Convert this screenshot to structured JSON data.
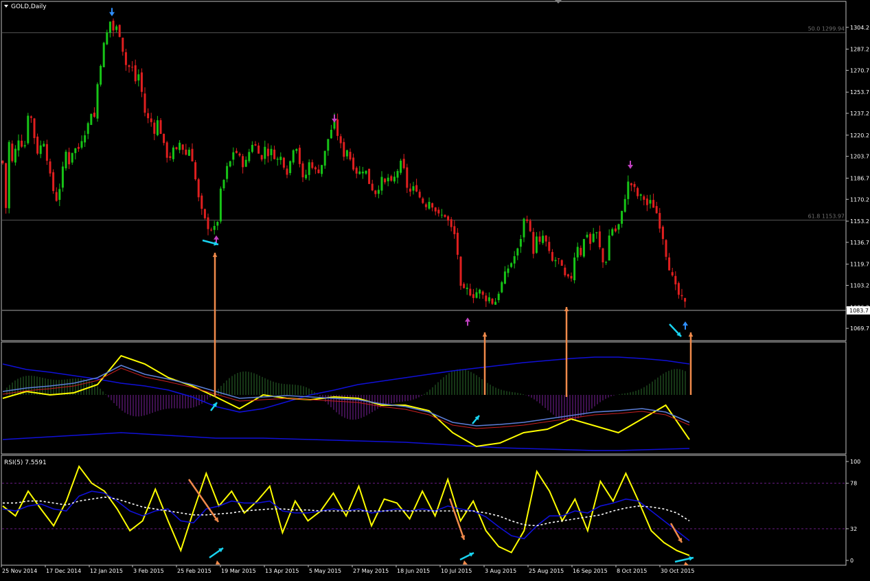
{
  "window": {
    "symbol_label": "GOLD,Daily",
    "rsi_label": "RSI(5) 7.5591"
  },
  "colors": {
    "bg": "#000000",
    "grid": "#2f3b2f",
    "axis": "#c0c0c0",
    "bull": "#17c417",
    "bear": "#e01f1f",
    "yellow": "#ffff00",
    "blue": "#1010d8",
    "lightblue": "#5c7fd8",
    "orange": "#f08a4b",
    "cyan": "#19d3f0",
    "purple": "#a020a0",
    "fib": "#707070",
    "price_line": "#c0c0c0"
  },
  "icons": {
    "dropdown": "triangle-down-icon",
    "buy": "arrow-up-icon",
    "sell": "arrow-down-icon"
  },
  "chart_data": [
    {
      "type": "candlestick",
      "title": "GOLD,Daily",
      "ylim": [
        1061.2,
        1321.2
      ],
      "y_ticks": [
        "1304.2",
        "1287.2",
        "1270.7",
        "1253.7",
        "1237.2",
        "1220.2",
        "1203.7",
        "1186.7",
        "1170.2",
        "1153.2",
        "1136.7",
        "1119.7",
        "1103.2",
        "1086.2",
        "1069.7"
      ],
      "x_ticks": [
        "25 Nov 2014",
        "17 Dec 2014",
        "12 Jan 2015",
        "3 Feb 2015",
        "25 Feb 2015",
        "19 Mar 2015",
        "13 Apr 2015",
        "5 May 2015",
        "27 May 2015",
        "18 Jun 2015",
        "10 Jul 2015",
        "3 Aug 2015",
        "25 Aug 2015",
        "16 Sep 2015",
        "8 Oct 2015",
        "30 Oct 2015"
      ],
      "current_price": "1083.7",
      "fib_levels": [
        {
          "label": "50.0 1299.94",
          "value": 1299.94
        },
        {
          "label": "61.8 1153.97",
          "value": 1153.97
        }
      ],
      "close_path": [
        [
          0,
          1200
        ],
        [
          5,
          1198
        ],
        [
          9,
          1160
        ],
        [
          13,
          1215
        ],
        [
          19,
          1195
        ],
        [
          24,
          1215
        ],
        [
          29,
          1220
        ],
        [
          35,
          1205
        ],
        [
          40,
          1238
        ],
        [
          47,
          1232
        ],
        [
          52,
          1210
        ],
        [
          57,
          1205
        ],
        [
          62,
          1220
        ],
        [
          67,
          1208
        ],
        [
          72,
          1190
        ],
        [
          77,
          1178
        ],
        [
          82,
          1170
        ],
        [
          87,
          1180
        ],
        [
          92,
          1195
        ],
        [
          97,
          1210
        ],
        [
          102,
          1195
        ],
        [
          107,
          1215
        ],
        [
          112,
          1205
        ],
        [
          117,
          1215
        ],
        [
          122,
          1222
        ],
        [
          127,
          1225
        ],
        [
          132,
          1240
        ],
        [
          137,
          1232
        ],
        [
          142,
          1260
        ],
        [
          146,
          1275
        ],
        [
          151,
          1290
        ],
        [
          156,
          1300
        ],
        [
          161,
          1310
        ],
        [
          166,
          1300
        ],
        [
          171,
          1305
        ],
        [
          176,
          1296
        ],
        [
          181,
          1280
        ],
        [
          186,
          1270
        ],
        [
          191,
          1278
        ],
        [
          196,
          1260
        ],
        [
          201,
          1270
        ],
        [
          206,
          1255
        ],
        [
          211,
          1238
        ],
        [
          216,
          1232
        ],
        [
          221,
          1230
        ],
        [
          226,
          1222
        ],
        [
          231,
          1235
        ],
        [
          236,
          1215
        ],
        [
          241,
          1208
        ],
        [
          246,
          1200
        ],
        [
          251,
          1210
        ],
        [
          256,
          1205
        ],
        [
          261,
          1215
        ],
        [
          266,
          1210
        ],
        [
          271,
          1205
        ],
        [
          276,
          1210
        ],
        [
          281,
          1200
        ],
        [
          286,
          1180
        ],
        [
          291,
          1165
        ],
        [
          296,
          1157
        ],
        [
          301,
          1150
        ],
        [
          306,
          1148
        ],
        [
          311,
          1146
        ],
        [
          316,
          1150
        ],
        [
          321,
          1175
        ],
        [
          326,
          1185
        ],
        [
          331,
          1195
        ],
        [
          336,
          1200
        ],
        [
          341,
          1210
        ],
        [
          346,
          1205
        ],
        [
          351,
          1200
        ],
        [
          356,
          1196
        ],
        [
          361,
          1203
        ],
        [
          366,
          1215
        ],
        [
          371,
          1212
        ],
        [
          376,
          1210
        ],
        [
          381,
          1200
        ],
        [
          386,
          1212
        ],
        [
          391,
          1205
        ],
        [
          396,
          1208
        ],
        [
          401,
          1203
        ],
        [
          406,
          1200
        ],
        [
          411,
          1205
        ],
        [
          416,
          1190
        ],
        [
          421,
          1195
        ],
        [
          426,
          1210
        ],
        [
          431,
          1214
        ],
        [
          436,
          1200
        ],
        [
          441,
          1185
        ],
        [
          446,
          1190
        ],
        [
          451,
          1200
        ],
        [
          456,
          1196
        ],
        [
          461,
          1190
        ],
        [
          466,
          1195
        ],
        [
          471,
          1200
        ],
        [
          476,
          1215
        ],
        [
          481,
          1222
        ],
        [
          486,
          1232
        ],
        [
          491,
          1222
        ],
        [
          496,
          1212
        ],
        [
          501,
          1205
        ],
        [
          506,
          1210
        ],
        [
          511,
          1200
        ],
        [
          516,
          1195
        ],
        [
          521,
          1190
        ],
        [
          526,
          1192
        ],
        [
          531,
          1196
        ],
        [
          536,
          1185
        ],
        [
          541,
          1180
        ],
        [
          546,
          1175
        ],
        [
          551,
          1180
        ],
        [
          556,
          1185
        ],
        [
          561,
          1182
        ],
        [
          566,
          1188
        ],
        [
          571,
          1180
        ],
        [
          576,
          1190
        ],
        [
          581,
          1195
        ],
        [
          586,
          1200
        ],
        [
          591,
          1183
        ],
        [
          596,
          1175
        ],
        [
          601,
          1178
        ],
        [
          606,
          1180
        ],
        [
          611,
          1172
        ],
        [
          616,
          1168
        ],
        [
          621,
          1166
        ],
        [
          626,
          1170
        ],
        [
          631,
          1165
        ],
        [
          636,
          1160
        ],
        [
          641,
          1155
        ],
        [
          646,
          1160
        ],
        [
          651,
          1155
        ],
        [
          656,
          1148
        ],
        [
          661,
          1145
        ],
        [
          666,
          1130
        ],
        [
          671,
          1100
        ],
        [
          676,
          1098
        ],
        [
          681,
          1100
        ],
        [
          686,
          1097
        ],
        [
          691,
          1095
        ],
        [
          696,
          1100
        ],
        [
          701,
          1097
        ],
        [
          706,
          1092
        ],
        [
          711,
          1095
        ],
        [
          716,
          1090
        ],
        [
          721,
          1090
        ],
        [
          726,
          1098
        ],
        [
          731,
          1105
        ],
        [
          736,
          1112
        ],
        [
          741,
          1118
        ],
        [
          746,
          1122
        ],
        [
          751,
          1128
        ],
        [
          756,
          1132
        ],
        [
          761,
          1150
        ],
        [
          766,
          1160
        ],
        [
          771,
          1148
        ],
        [
          776,
          1128
        ],
        [
          781,
          1140
        ],
        [
          786,
          1135
        ],
        [
          791,
          1142
        ],
        [
          796,
          1135
        ],
        [
          801,
          1125
        ],
        [
          806,
          1120
        ],
        [
          811,
          1125
        ],
        [
          816,
          1120
        ],
        [
          821,
          1110
        ],
        [
          826,
          1108
        ],
        [
          831,
          1106
        ],
        [
          836,
          1125
        ],
        [
          841,
          1135
        ],
        [
          846,
          1128
        ],
        [
          851,
          1140
        ],
        [
          856,
          1145
        ],
        [
          861,
          1132
        ],
        [
          866,
          1150
        ],
        [
          871,
          1138
        ],
        [
          876,
          1125
        ],
        [
          881,
          1115
        ],
        [
          886,
          1140
        ],
        [
          891,
          1148
        ],
        [
          896,
          1145
        ],
        [
          901,
          1150
        ],
        [
          906,
          1160
        ],
        [
          911,
          1175
        ],
        [
          916,
          1185
        ],
        [
          921,
          1180
        ],
        [
          926,
          1176
        ],
        [
          931,
          1170
        ],
        [
          936,
          1174
        ],
        [
          941,
          1165
        ],
        [
          946,
          1168
        ],
        [
          951,
          1166
        ],
        [
          956,
          1160
        ],
        [
          961,
          1150
        ],
        [
          966,
          1140
        ],
        [
          971,
          1125
        ],
        [
          976,
          1115
        ],
        [
          981,
          1105
        ],
        [
          986,
          1098
        ],
        [
          991,
          1093
        ],
        [
          996,
          1090
        ],
        [
          1001,
          1085
        ]
      ],
      "signals": [
        {
          "kind": "sell",
          "x": 163,
          "price": 1315,
          "color": "blue"
        },
        {
          "kind": "sell",
          "x": 487,
          "price": 1232,
          "color": "purple"
        },
        {
          "kind": "sell",
          "x": 918,
          "price": 1196,
          "color": "purple"
        },
        {
          "kind": "buy",
          "x": 315,
          "price": 1140,
          "color": "purple"
        },
        {
          "kind": "buy",
          "x": 681,
          "price": 1076,
          "color": "purple"
        },
        {
          "kind": "buy",
          "x": 998,
          "price": 1073,
          "color": "blue"
        }
      ]
    },
    {
      "type": "line",
      "title": "",
      "series": [
        {
          "role": "band_upper",
          "values": [
            30,
            38,
            42,
            47,
            52,
            58,
            62,
            68,
            78,
            92,
            100,
            95,
            85,
            75,
            68,
            60,
            55,
            50,
            45,
            40,
            36,
            32,
            28,
            25,
            22,
            20,
            20,
            22,
            25,
            30
          ]
        },
        {
          "role": "band_lower",
          "values": [
            140,
            138,
            136,
            134,
            132,
            130,
            132,
            134,
            136,
            138,
            138,
            138,
            139,
            140,
            141,
            142,
            143,
            144,
            146,
            148,
            150,
            152,
            153,
            154,
            155,
            156,
            156,
            155,
            154,
            153
          ]
        },
        {
          "role": "fast",
          "values": [
            80,
            70,
            75,
            72,
            60,
            18,
            30,
            50,
            62,
            78,
            95,
            75,
            80,
            82,
            78,
            80,
            90,
            90,
            98,
            130,
            150,
            145,
            130,
            125,
            110,
            120,
            130,
            110,
            90,
            140
          ]
        },
        {
          "role": "slow",
          "values": [
            70,
            65,
            62,
            58,
            50,
            32,
            45,
            52,
            60,
            70,
            80,
            78,
            76,
            78,
            80,
            82,
            88,
            92,
            100,
            115,
            120,
            118,
            115,
            110,
            105,
            100,
            98,
            95,
            100,
            115
          ]
        }
      ]
    },
    {
      "type": "line",
      "title": "RSI(5) 7.5591",
      "ylim": [
        0,
        100
      ],
      "y_ticks": [
        "100",
        "78",
        "32",
        "0"
      ],
      "levels": [
        78,
        32
      ],
      "series": [
        {
          "role": "rsi",
          "values": [
            55,
            45,
            70,
            52,
            35,
            60,
            95,
            78,
            70,
            52,
            30,
            40,
            72,
            40,
            10,
            50,
            88,
            55,
            70,
            48,
            60,
            75,
            28,
            60,
            40,
            50,
            68,
            45,
            75,
            35,
            62,
            58,
            42,
            70,
            45,
            82,
            40,
            60,
            30,
            14,
            8,
            30,
            90,
            70,
            40,
            62,
            30,
            80,
            60,
            88,
            60,
            30,
            18,
            10,
            5
          ]
        },
        {
          "role": "rsi_ma",
          "values": [
            52,
            50,
            55,
            57,
            52,
            50,
            65,
            70,
            68,
            60,
            50,
            45,
            50,
            52,
            40,
            38,
            52,
            55,
            60,
            58,
            58,
            60,
            50,
            48,
            48,
            50,
            52,
            50,
            52,
            48,
            50,
            52,
            50,
            52,
            50,
            55,
            52,
            50,
            44,
            34,
            25,
            22,
            35,
            45,
            45,
            50,
            48,
            55,
            58,
            62,
            60,
            50,
            40,
            30,
            20
          ]
        },
        {
          "role": "rsi_signal",
          "values": [
            58,
            58,
            60,
            60,
            58,
            56,
            60,
            62,
            64,
            62,
            58,
            54,
            52,
            50,
            48,
            46,
            46,
            47,
            48,
            50,
            51,
            52,
            52,
            51,
            51,
            50,
            50,
            50,
            50,
            50,
            50,
            50,
            50,
            50,
            50,
            50,
            50,
            50,
            48,
            45,
            40,
            36,
            35,
            38,
            40,
            42,
            44,
            46,
            50,
            53,
            55,
            54,
            52,
            48,
            40
          ]
        }
      ],
      "annotations": [
        {
          "kind": "orange-down",
          "x": 318,
          "value": 38
        },
        {
          "kind": "orange-down",
          "x": 676,
          "value": 26
        },
        {
          "kind": "orange-down",
          "x": 993,
          "value": 20
        },
        {
          "kind": "cyan-up",
          "x": 316,
          "value": 10
        },
        {
          "kind": "cyan-up",
          "x": 681,
          "value": 6
        },
        {
          "kind": "cyan-right",
          "x": 998,
          "value": 4
        }
      ]
    }
  ]
}
